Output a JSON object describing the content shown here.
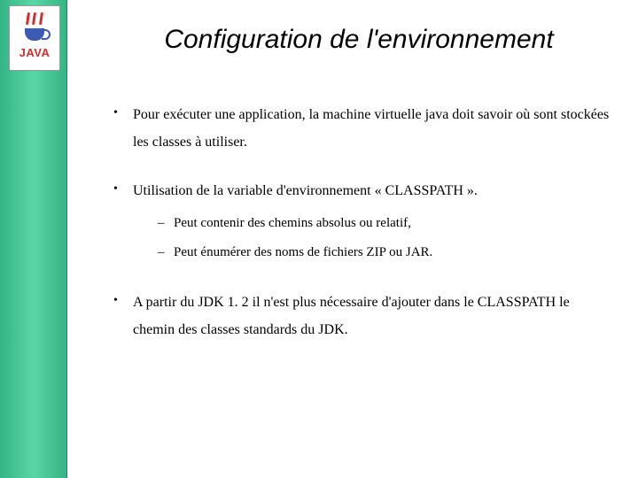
{
  "logo": {
    "text": "JAVA"
  },
  "slide": {
    "title": "Configuration de l'environnement",
    "bullets": [
      {
        "text": "Pour exécuter une application, la machine virtuelle java doit savoir où sont stockées les classes à utiliser.",
        "sub": []
      },
      {
        "text": "Utilisation de la variable d'environnement « CLASSPATH ».",
        "sub": [
          "Peut contenir des chemins absolus ou relatif,",
          "Peut énumérer des noms de fichiers ZIP ou JAR."
        ]
      },
      {
        "text": "A partir du JDK 1. 2 il n'est plus nécessaire d'ajouter dans le CLASSPATH le chemin des classes standards du JDK.",
        "sub": []
      }
    ]
  }
}
